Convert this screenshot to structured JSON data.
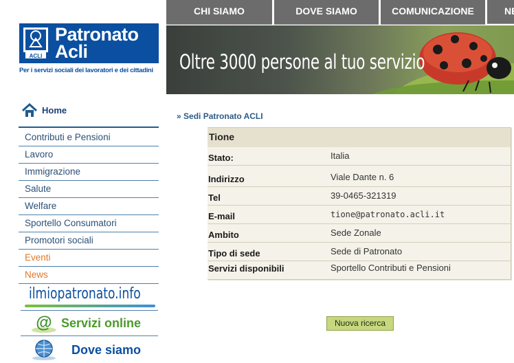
{
  "nav": {
    "tabs": [
      {
        "label": "CHI SIAMO"
      },
      {
        "label": "DOVE SIAMO"
      },
      {
        "label": "COMUNICAZIONE"
      },
      {
        "label": "NE"
      }
    ]
  },
  "brand": {
    "line1": "Patronato",
    "line2": "Acli",
    "emblem_text": "ACLI",
    "tagline": "Per i servizi sociali dei lavoratori e dei cittadini",
    "color": "#0b4fa0"
  },
  "banner": {
    "headline": "Oltre 3000 persone al tuo servizio"
  },
  "sidebar": {
    "home_label": "Home",
    "items": [
      {
        "label": "Contributi e Pensioni"
      },
      {
        "label": "Lavoro"
      },
      {
        "label": "Immigrazione"
      },
      {
        "label": "Salute"
      },
      {
        "label": "Welfare"
      },
      {
        "label": "Sportello Consumatori"
      },
      {
        "label": "Promotori sociali"
      },
      {
        "label": "Eventi"
      },
      {
        "label": "News"
      }
    ],
    "promos": {
      "ilmiopatronato": "ilmiopatronato.info",
      "servizi_online": "Servizi online",
      "dove_siamo": "Dove siamo"
    }
  },
  "breadcrumb": {
    "marker": "»",
    "label": "Sedi Patronato ACLI"
  },
  "office": {
    "name": "Tione",
    "rows": [
      {
        "label": "Stato:",
        "value": "Italia"
      },
      {
        "label": "Indirizzo",
        "value": "Viale Dante n. 6"
      },
      {
        "label": "Tel",
        "value": "39-0465-321319"
      },
      {
        "label": "E-mail",
        "value": "tione@patronato.acli.it"
      },
      {
        "label": "Ambito",
        "value": "Sede Zonale"
      },
      {
        "label": "Tipo di sede",
        "value": "Sede di Patronato"
      },
      {
        "label": "Servizi disponibili",
        "value": "Sportello Contributi e Pensioni"
      }
    ]
  },
  "actions": {
    "new_search": "Nuova ricerca"
  },
  "colors": {
    "nav_tab": "#6c6c6c",
    "sidebar_text": "#2b4f76",
    "sidebar_accent": "#e0792a",
    "card_bg": "#f4f2e9",
    "button_bg": "#c7d77f"
  }
}
